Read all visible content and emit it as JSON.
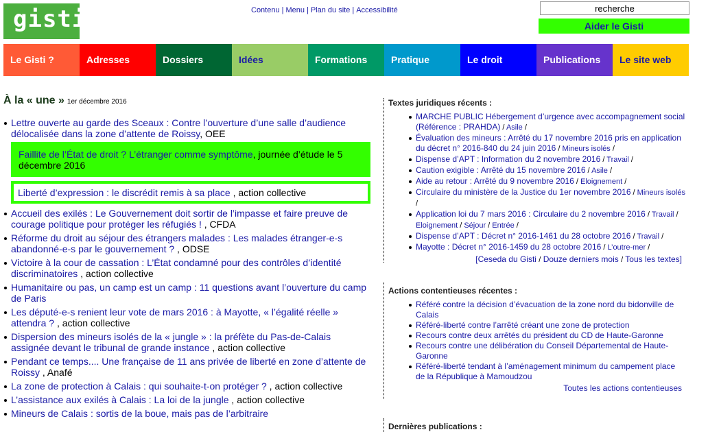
{
  "logo": "gisti,",
  "toplinks": [
    "Contenu",
    "Menu",
    "Plan du site",
    "Accessibilité"
  ],
  "search": {
    "value": "recherche"
  },
  "aider": "Aider le Gisti",
  "nav": [
    {
      "label": "Le Gisti ?",
      "bg": "#ff5a36",
      "fg": "#ffffff"
    },
    {
      "label": "Adresses",
      "bg": "#ff0000",
      "fg": "#ffffff"
    },
    {
      "label": "Dossiers",
      "bg": "#006633",
      "fg": "#ffffff"
    },
    {
      "label": "Idées",
      "bg": "#99cc66",
      "fg": "#1a1aa6"
    },
    {
      "label": "Formations",
      "bg": "#009966",
      "fg": "#ffffff"
    },
    {
      "label": "Pratique",
      "bg": "#0099cc",
      "fg": "#ffffff"
    },
    {
      "label": "Le droit",
      "bg": "#0000ff",
      "fg": "#ffffff"
    },
    {
      "label": "Publications",
      "bg": "#6633cc",
      "fg": "#ffffff"
    },
    {
      "label": "Le site web",
      "bg": "#ffcc00",
      "fg": "#1a1aa6"
    }
  ],
  "une": {
    "title": "À la « une »",
    "date": "1er décembre 2016"
  },
  "news": [
    {
      "link": "Lettre ouverte au garde des Sceaux  : Contre l’ouverture d’une salle d’audience délocalisée dans la zone d’attente de Roissy",
      "src": ", OEE"
    },
    {
      "link": "Faillite de l’État de droit ? L’étranger comme symptôme",
      "src": ", journée d’étude le 5 décembre 2016"
    },
    {
      "link": "Liberté d’expression : le discrédit remis à sa place",
      "src": " , action collective"
    },
    {
      "link": "Accueil des exilés : Le Gouvernement doit sortir de l’impasse et faire preuve de courage politique pour protéger les réfugiés !",
      "src": " , CFDA"
    },
    {
      "link": "Réforme du droit au séjour des étrangers malades : Les malades étranger-e-s abandonné-e-s par le gouvernement ?",
      "src": " , ODSE"
    },
    {
      "link": "Victoire à la cour de cassation : L’État condamné pour des contrôles d’identité discriminatoires",
      "src": " , action collective"
    },
    {
      "link": "Humanitaire ou pas, un camp est un camp  : 11 questions avant l’ouverture du camp de Paris",
      "src": ""
    },
    {
      "link": "Les député-e-s renient leur vote de mars 2016 : à Mayotte, « l’égalité réelle » attendra ?",
      "src": " , action collective"
    },
    {
      "link": "Dispersion des mineurs isolés de la « jungle » : la préfète du Pas-de-Calais assignée devant le tribunal de grande instance",
      "src": " , action collective"
    },
    {
      "link": "Pendant ce temps.... Une française de 11 ans privée de liberté en zone d’attente de Roissy",
      "src": " , Anafé"
    },
    {
      "link": "La zone de protection à Calais : qui souhaite-t-on protéger ?",
      "src": " , action collective"
    },
    {
      "link": "L’assistance aux exilés à Calais : La loi de la jungle",
      "src": " , action collective"
    },
    {
      "link": "Mineurs de Calais : sortis de la boue, mais pas de l’arbitraire",
      "src": ""
    }
  ],
  "textes": {
    "title": "Textes juridiques récents :",
    "items": [
      {
        "link": "MARCHE PUBLIC Hébergement d’urgence avec accompagnement social (Référence : PRAHDA)",
        "tags": [
          "Asile"
        ]
      },
      {
        "link": "Évaluation des mineurs : Arrêté du 17 novembre 2016 pris en application du décret n° 2016-840 du 24 juin 2016",
        "tags": [
          "Mineurs isolés"
        ]
      },
      {
        "link": "Dispense d’APT : Information du 2 novembre 2016",
        "tags": [
          "Travail"
        ]
      },
      {
        "link": "Caution exigible : Arrêté du 15 novembre 2016",
        "tags": [
          "Asile"
        ]
      },
      {
        "link": "Aide au retour : Arrêté du 9 novembre 2016",
        "tags": [
          "Eloignement"
        ]
      },
      {
        "link": "Circulaire du ministère de la Justice du 1er novembre 2016",
        "tags": [
          "Mineurs isolés"
        ]
      },
      {
        "link": "Application loi du 7 mars 2016 : Circulaire du 2 novembre 2016",
        "tags": [
          "Travail",
          "Eloignement",
          "Séjour",
          "Entrée"
        ]
      },
      {
        "link": "Dispense d’APT : Décret n° 2016-1461 du 28 octobre 2016",
        "tags": [
          "Travail"
        ]
      },
      {
        "link": "Mayotte : Décret n° 2016-1459 du 28 octobre 2016",
        "tags": [
          "L’outre-mer"
        ]
      }
    ],
    "more": [
      "[Ceseda du Gisti",
      "Douze derniers mois",
      "Tous les textes]"
    ]
  },
  "actions": {
    "title": "Actions contentieuses récentes :",
    "items": [
      "Référé contre la décision d’évacuation de la zone nord du bidonville de Calais",
      "Référé-liberté contre l’arrêté créant une zone de protection",
      "Recours contre deux arrêtés du président du CD de Haute-Garonne",
      "Recours contre une délibération du Conseil Départemental de Haute-Garonne",
      "Référé-liberté tendant à l’aménagement minimum du campement place de la République à Mamoudzou"
    ],
    "more": "Toutes les actions contentieuses"
  },
  "publications": {
    "title": "Dernières publications :"
  }
}
